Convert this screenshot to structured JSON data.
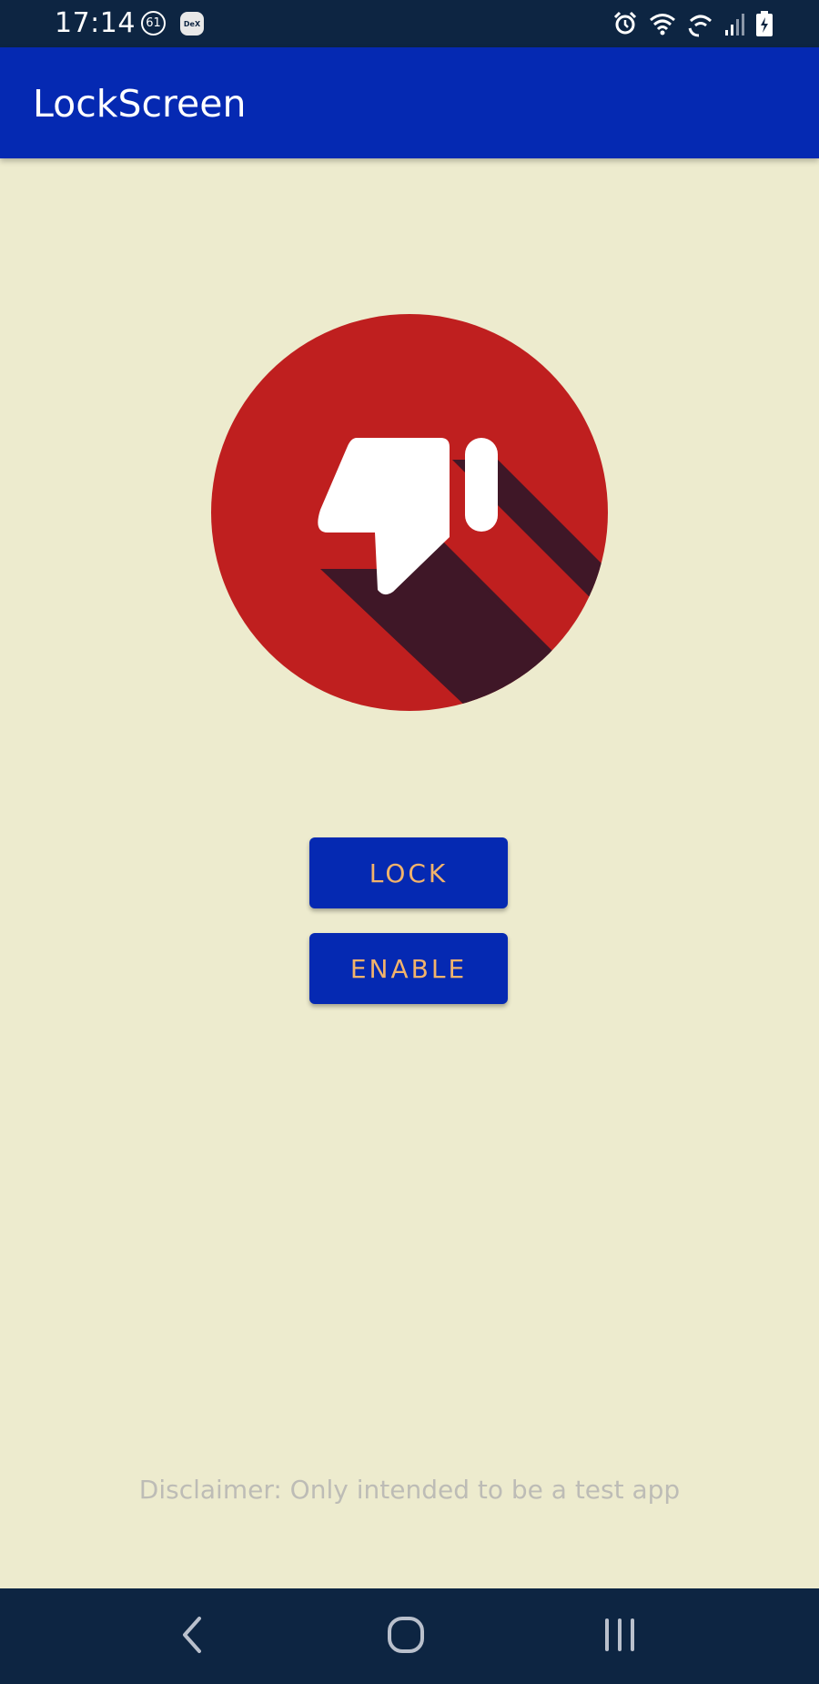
{
  "status_bar": {
    "time": "17:14",
    "notification_badge": "61",
    "dex_label": "DeX",
    "battery_level": "7",
    "icons": [
      "alarm-icon",
      "wifi-icon",
      "wifi-calling-icon",
      "signal-icon",
      "battery-charging-icon"
    ]
  },
  "app_bar": {
    "title": "LockScreen",
    "color": "#0529b2"
  },
  "hero": {
    "icon": "thumbs-down-icon",
    "circle_color": "#bf1f1f",
    "shadow_color": "#3f1727",
    "glyph_color": "#ffffff"
  },
  "buttons": {
    "lock_label": "LOCK",
    "enable_label": "ENABLE",
    "label_color": "#f2b36b"
  },
  "footer": {
    "disclaimer": "Disclaimer: Only intended to be a test app"
  },
  "nav_bar": {
    "icons": [
      "back-icon",
      "home-icon",
      "recents-icon"
    ]
  },
  "colors": {
    "background": "#edebce",
    "system_bars": "#0d2542"
  }
}
